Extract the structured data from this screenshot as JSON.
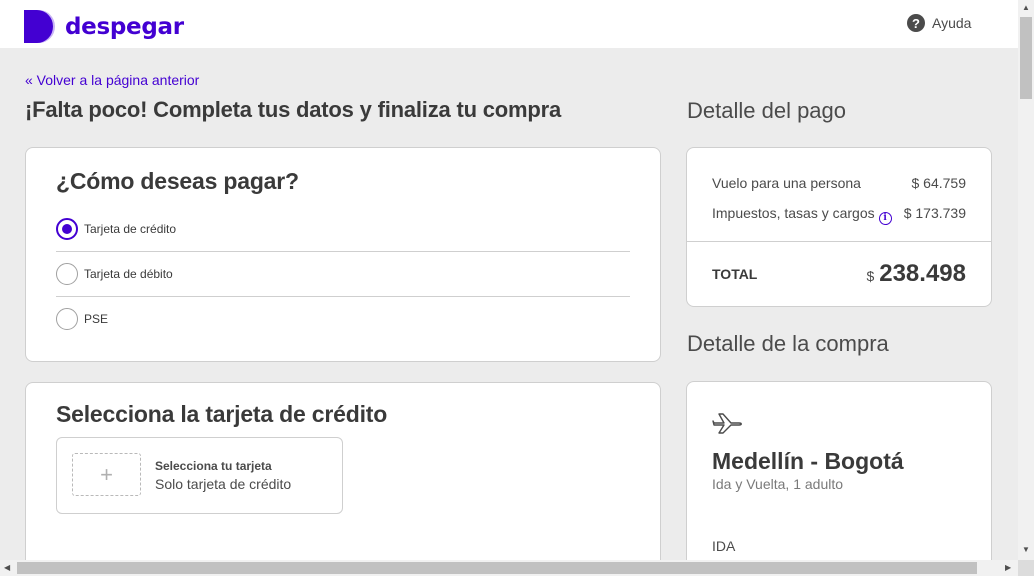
{
  "header": {
    "brand": "despegar",
    "help_label": "Ayuda",
    "help_glyph": "?",
    "brand_color": "#4300d2"
  },
  "nav": {
    "back_label": "« Volver a la página anterior"
  },
  "main": {
    "title": "¡Falta poco! Completa tus datos y finaliza tu compra",
    "payment_method": {
      "heading": "¿Cómo deseas pagar?",
      "options": [
        {
          "label": "Tarjeta de crédito",
          "selected": true
        },
        {
          "label": "Tarjeta de débito",
          "selected": false
        },
        {
          "label": "PSE",
          "selected": false
        }
      ]
    },
    "card_selection": {
      "heading": "Selecciona la tarjeta de crédito",
      "add_glyph": "+",
      "select_title": "Selecciona tu tarjeta",
      "select_subtitle": "Solo tarjeta de crédito"
    }
  },
  "payment_detail": {
    "title": "Detalle del pago",
    "rows": [
      {
        "label": "Vuelo para una persona",
        "amount": "$ 64.759"
      },
      {
        "label": "Impuestos, tasas y cargos",
        "amount": "$ 173.739"
      }
    ],
    "info_glyph": "i",
    "total_label": "TOTAL",
    "total_currency": "$",
    "total_value": "238.498"
  },
  "purchase_detail": {
    "title": "Detalle de la compra",
    "icon": "airplane-icon",
    "route": "Medellín - Bogotá",
    "route_info": "Ida y Vuelta, 1 adulto",
    "leg_label": "IDA"
  }
}
